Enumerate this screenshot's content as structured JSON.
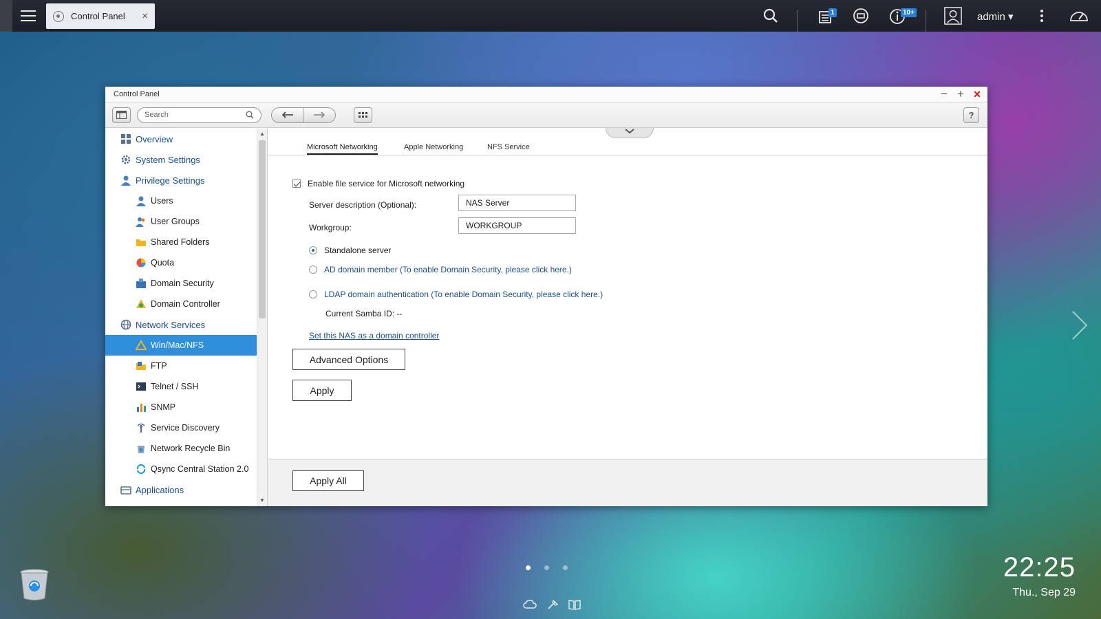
{
  "taskbar": {
    "tab_label": "Control Panel",
    "tab_close": "×",
    "notifications_badge": "1",
    "info_badge": "10+",
    "user": "admin ▾"
  },
  "window": {
    "title": "Control Panel",
    "search_placeholder": "Search",
    "help_label": "?"
  },
  "sidebar": {
    "items": [
      {
        "label": "Overview",
        "kind": "cat",
        "icon": "overview-icon"
      },
      {
        "label": "System Settings",
        "kind": "cat",
        "icon": "gear-icon"
      },
      {
        "label": "Privilege Settings",
        "kind": "cat",
        "icon": "user-icon"
      },
      {
        "label": "Users",
        "kind": "sub",
        "icon": "user-icon"
      },
      {
        "label": "User Groups",
        "kind": "sub",
        "icon": "users-icon"
      },
      {
        "label": "Shared Folders",
        "kind": "sub",
        "icon": "folder-icon"
      },
      {
        "label": "Quota",
        "kind": "sub",
        "icon": "pie-icon"
      },
      {
        "label": "Domain Security",
        "kind": "sub",
        "icon": "domain-icon"
      },
      {
        "label": "Domain Controller",
        "kind": "sub",
        "icon": "controller-icon"
      },
      {
        "label": "Network Services",
        "kind": "cat",
        "icon": "globe-icon"
      },
      {
        "label": "Win/Mac/NFS",
        "kind": "sub",
        "icon": "winmac-icon",
        "active": true
      },
      {
        "label": "FTP",
        "kind": "sub",
        "icon": "ftp-icon"
      },
      {
        "label": "Telnet / SSH",
        "kind": "sub",
        "icon": "terminal-icon"
      },
      {
        "label": "SNMP",
        "kind": "sub",
        "icon": "bar-chart-icon"
      },
      {
        "label": "Service Discovery",
        "kind": "sub",
        "icon": "antenna-icon"
      },
      {
        "label": "Network Recycle Bin",
        "kind": "sub",
        "icon": "recycle-icon"
      },
      {
        "label": "Qsync Central Station 2.0",
        "kind": "sub",
        "icon": "sync-icon"
      },
      {
        "label": "Applications",
        "kind": "cat",
        "icon": "apps-icon"
      }
    ]
  },
  "tabs": [
    "Microsoft Networking",
    "Apple Networking",
    "NFS Service"
  ],
  "form": {
    "enable_label": "Enable file service for Microsoft networking",
    "desc_label": "Server description (Optional):",
    "desc_value": "NAS Server",
    "workgroup_label": "Workgroup:",
    "workgroup_value": "WORKGROUP",
    "radio_standalone": "Standalone server",
    "radio_ad": "AD domain member (To enable Domain Security, please click here.)",
    "radio_ldap": "LDAP domain authentication (To enable Domain Security, please click here.)",
    "samba_id": "Current Samba ID: --",
    "dc_link": "Set this NAS as a domain controller",
    "advanced": "Advanced Options",
    "apply": "Apply",
    "apply_all": "Apply All"
  },
  "clock": {
    "time": "22:25",
    "date": "Thu., Sep 29"
  },
  "colors": {
    "accent": "#2f8fdc",
    "link": "#1a4f8f",
    "close": "#d81b1b"
  }
}
